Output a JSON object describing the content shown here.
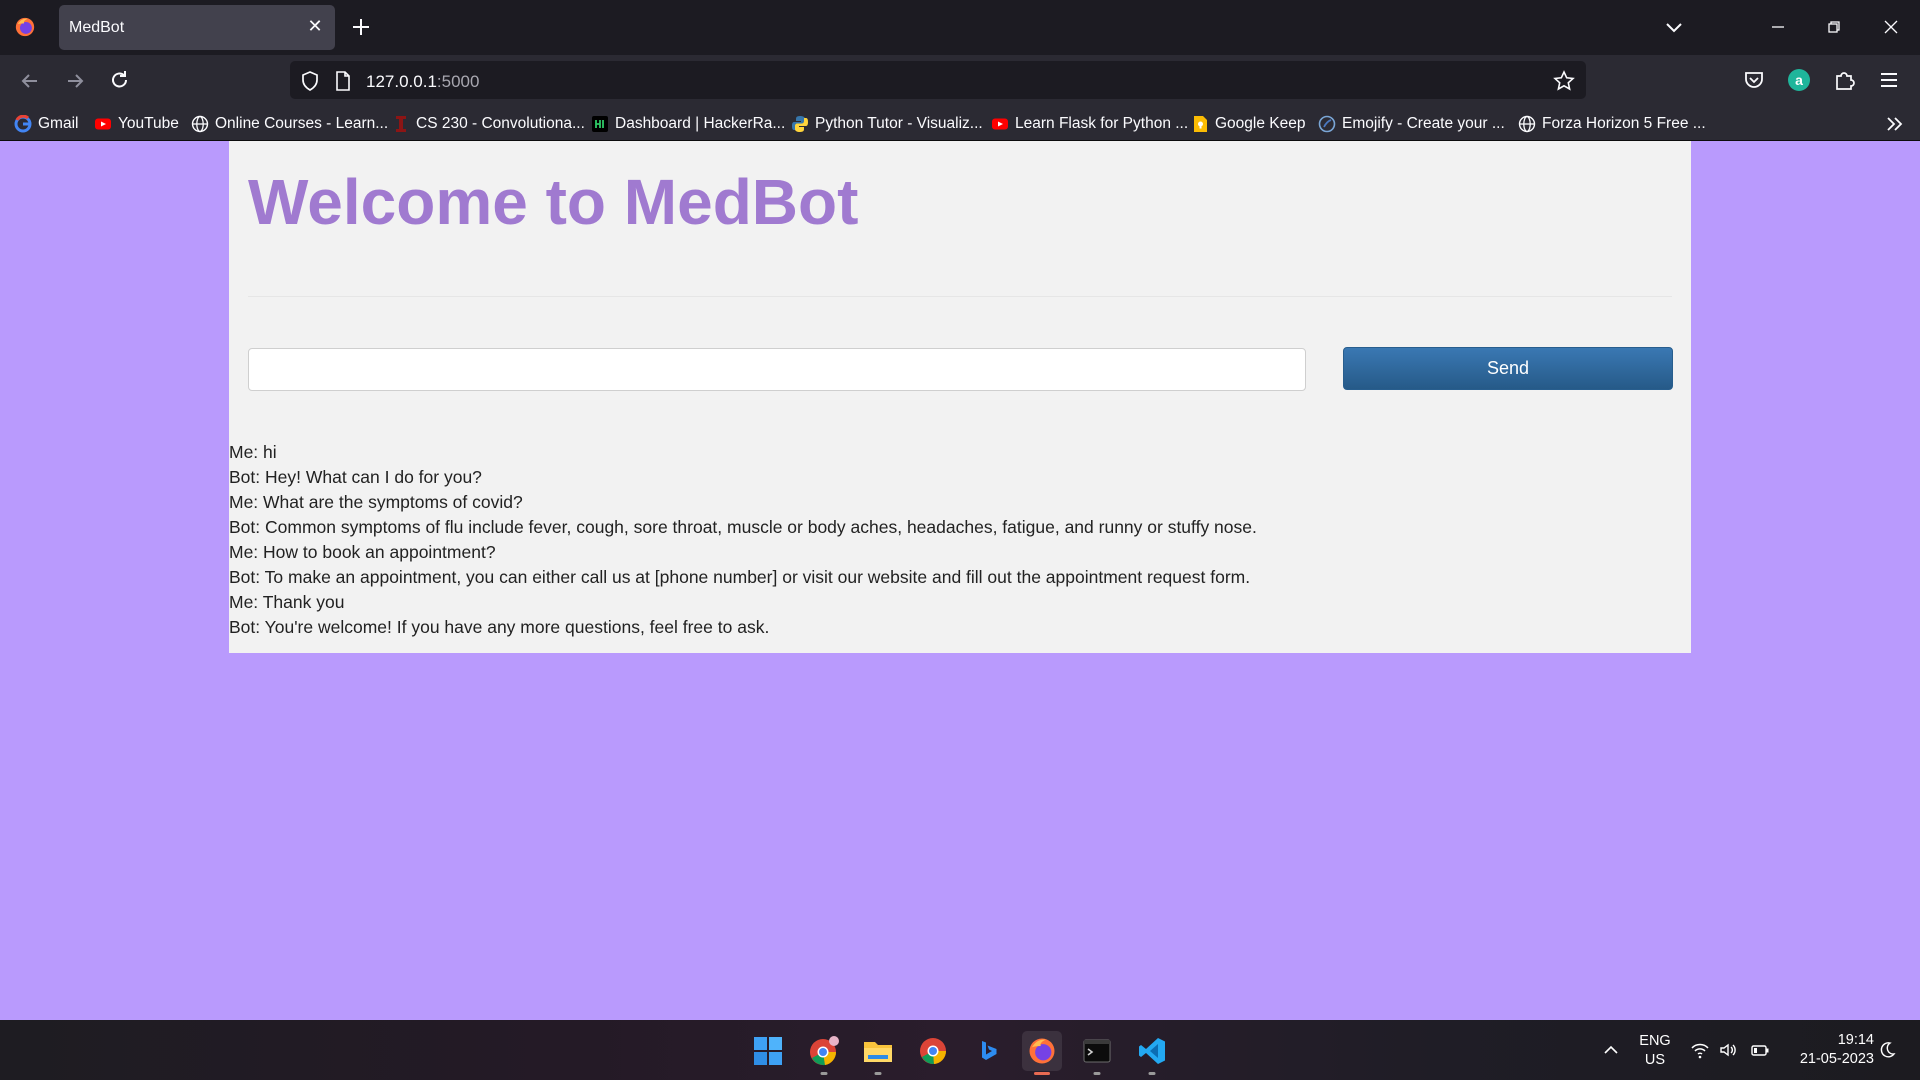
{
  "browser": {
    "tab_title": "MedBot",
    "url_host": "127.0.0.1",
    "url_port": ":5000",
    "bookmarks": [
      {
        "label": "Gmail",
        "icon": "google-icon"
      },
      {
        "label": "YouTube",
        "icon": "youtube-icon"
      },
      {
        "label": "Online Courses - Learn...",
        "icon": "globe-icon"
      },
      {
        "label": "CS 230 - Convolutiona...",
        "icon": "stanford-icon"
      },
      {
        "label": "Dashboard | HackerRa...",
        "icon": "hackerrank-icon"
      },
      {
        "label": "Python Tutor - Visualiz...",
        "icon": "python-icon"
      },
      {
        "label": "Learn Flask for Python ...",
        "icon": "youtube-icon"
      },
      {
        "label": "Google Keep",
        "icon": "google-keep-icon"
      },
      {
        "label": "Emojify - Create your ...",
        "icon": "emojify-icon"
      },
      {
        "label": "Forza Horizon 5 Free ...",
        "icon": "globe-icon"
      }
    ]
  },
  "page": {
    "title": "Welcome to MedBot",
    "input_value": "",
    "send_label": "Send",
    "messages": [
      "Me: hi",
      "Bot: Hey! What can I do for you?",
      "Me: What are the symptoms of covid?",
      "Bot: Common symptoms of flu include fever, cough, sore throat, muscle or body aches, headaches, fatigue, and runny or stuffy nose.",
      "Me: How to book an appointment?",
      "Bot: To make an appointment, you can either call us at [phone number] or visit our website and fill out the appointment request form.",
      "Me: Thank you",
      "Bot: You're welcome! If you have any more questions, feel free to ask."
    ]
  },
  "taskbar": {
    "apps": [
      "windows-start-icon",
      "chrome-profile-icon",
      "file-explorer-icon",
      "chrome-icon",
      "bing-icon",
      "firefox-icon",
      "terminal-icon",
      "vscode-icon"
    ],
    "lang": "ENG",
    "region": "US",
    "time": "19:14",
    "date": "21-05-2023"
  },
  "colors": {
    "page_background": "#b99afd",
    "title": "#a07ad0",
    "send_button": "#2f6da3"
  }
}
